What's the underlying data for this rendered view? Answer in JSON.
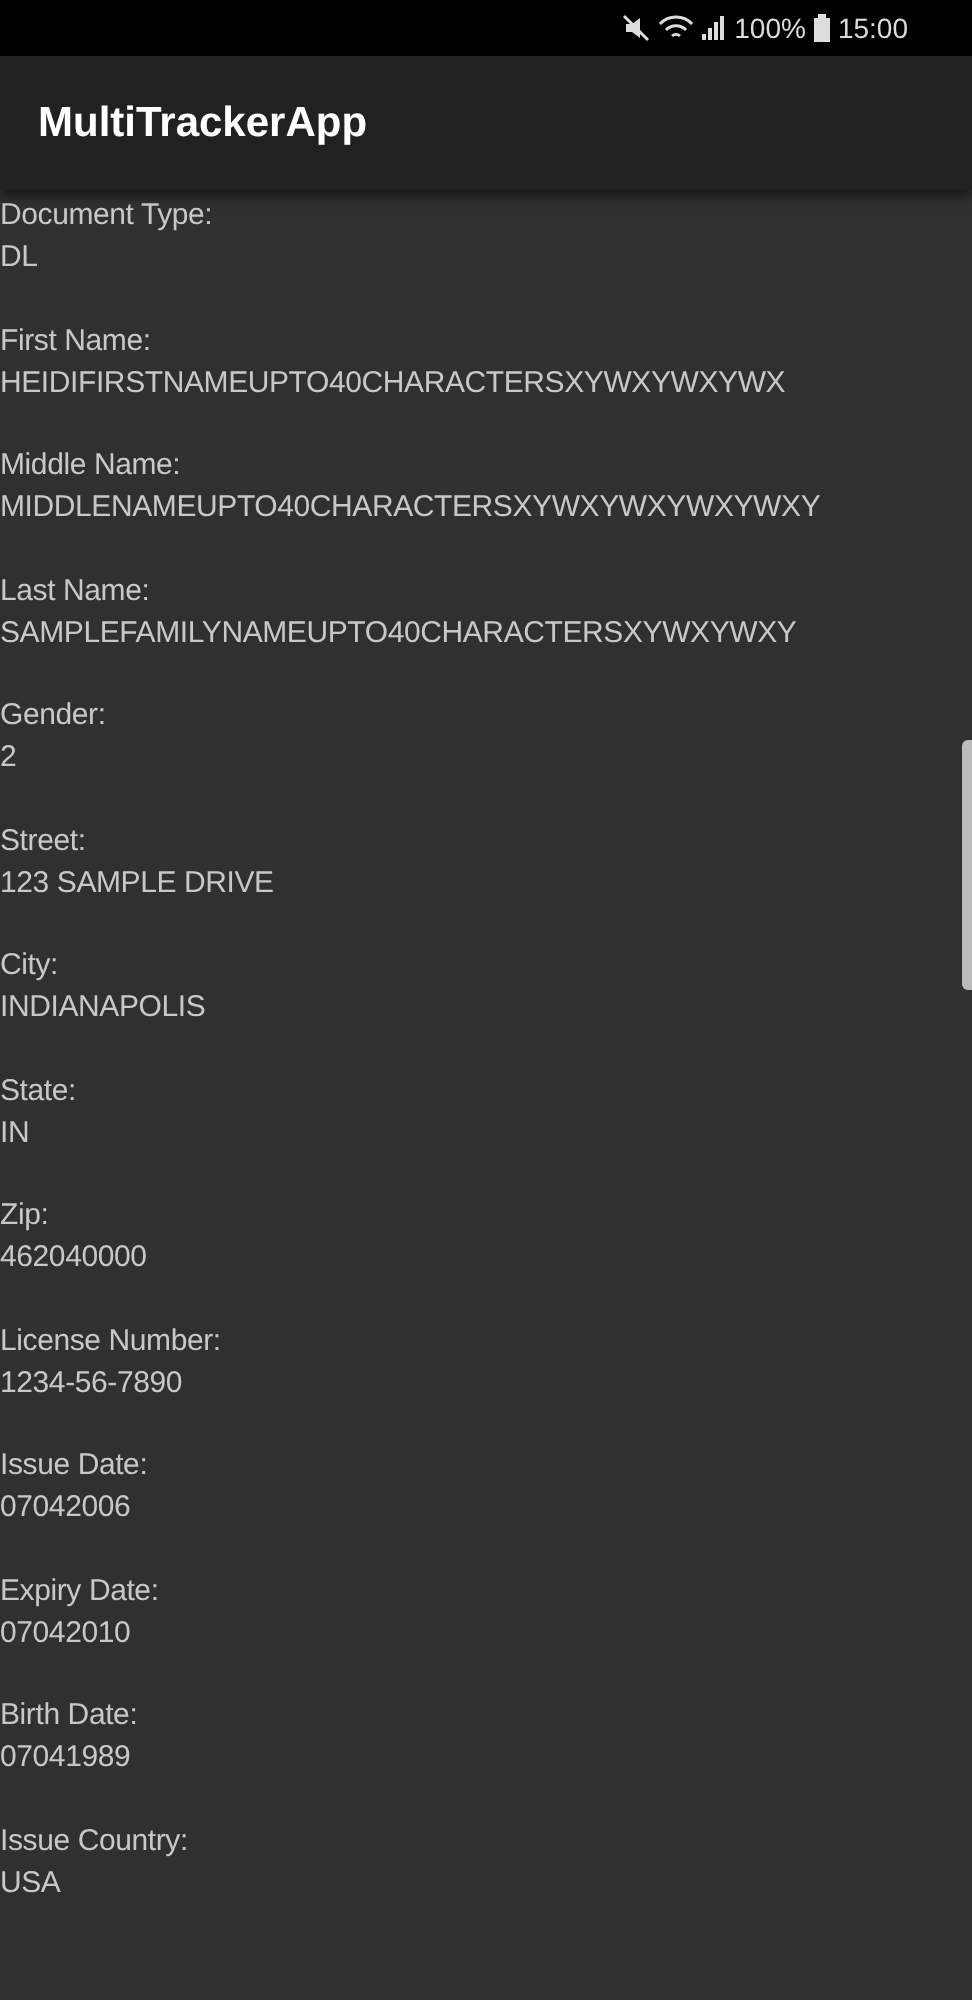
{
  "status_bar": {
    "battery": "100%",
    "time": "15:00"
  },
  "app_bar": {
    "title": "MultiTrackerApp"
  },
  "fields": [
    {
      "label": "Document Type:",
      "value": "DL"
    },
    {
      "label": "First Name:",
      "value": "HEIDIFIRSTNAMEUPTO40CHARACTERSXYWXYWXYWX"
    },
    {
      "label": "Middle Name:",
      "value": "MIDDLENAMEUPTO40CHARACTERSXYWXYWXYWXYWXY"
    },
    {
      "label": "Last Name:",
      "value": "SAMPLEFAMILYNAMEUPTO40CHARACTERSXYWXYWXY"
    },
    {
      "label": "Gender:",
      "value": "2"
    },
    {
      "label": "Street:",
      "value": "123 SAMPLE DRIVE"
    },
    {
      "label": "City:",
      "value": "INDIANAPOLIS"
    },
    {
      "label": "State:",
      "value": "IN"
    },
    {
      "label": "Zip:",
      "value": "462040000"
    },
    {
      "label": "License Number:",
      "value": "1234-56-7890"
    },
    {
      "label": "Issue Date:",
      "value": "07042006"
    },
    {
      "label": "Expiry Date:",
      "value": "07042010"
    },
    {
      "label": "Birth Date:",
      "value": "07041989"
    },
    {
      "label": "Issue Country:",
      "value": "USA"
    }
  ]
}
